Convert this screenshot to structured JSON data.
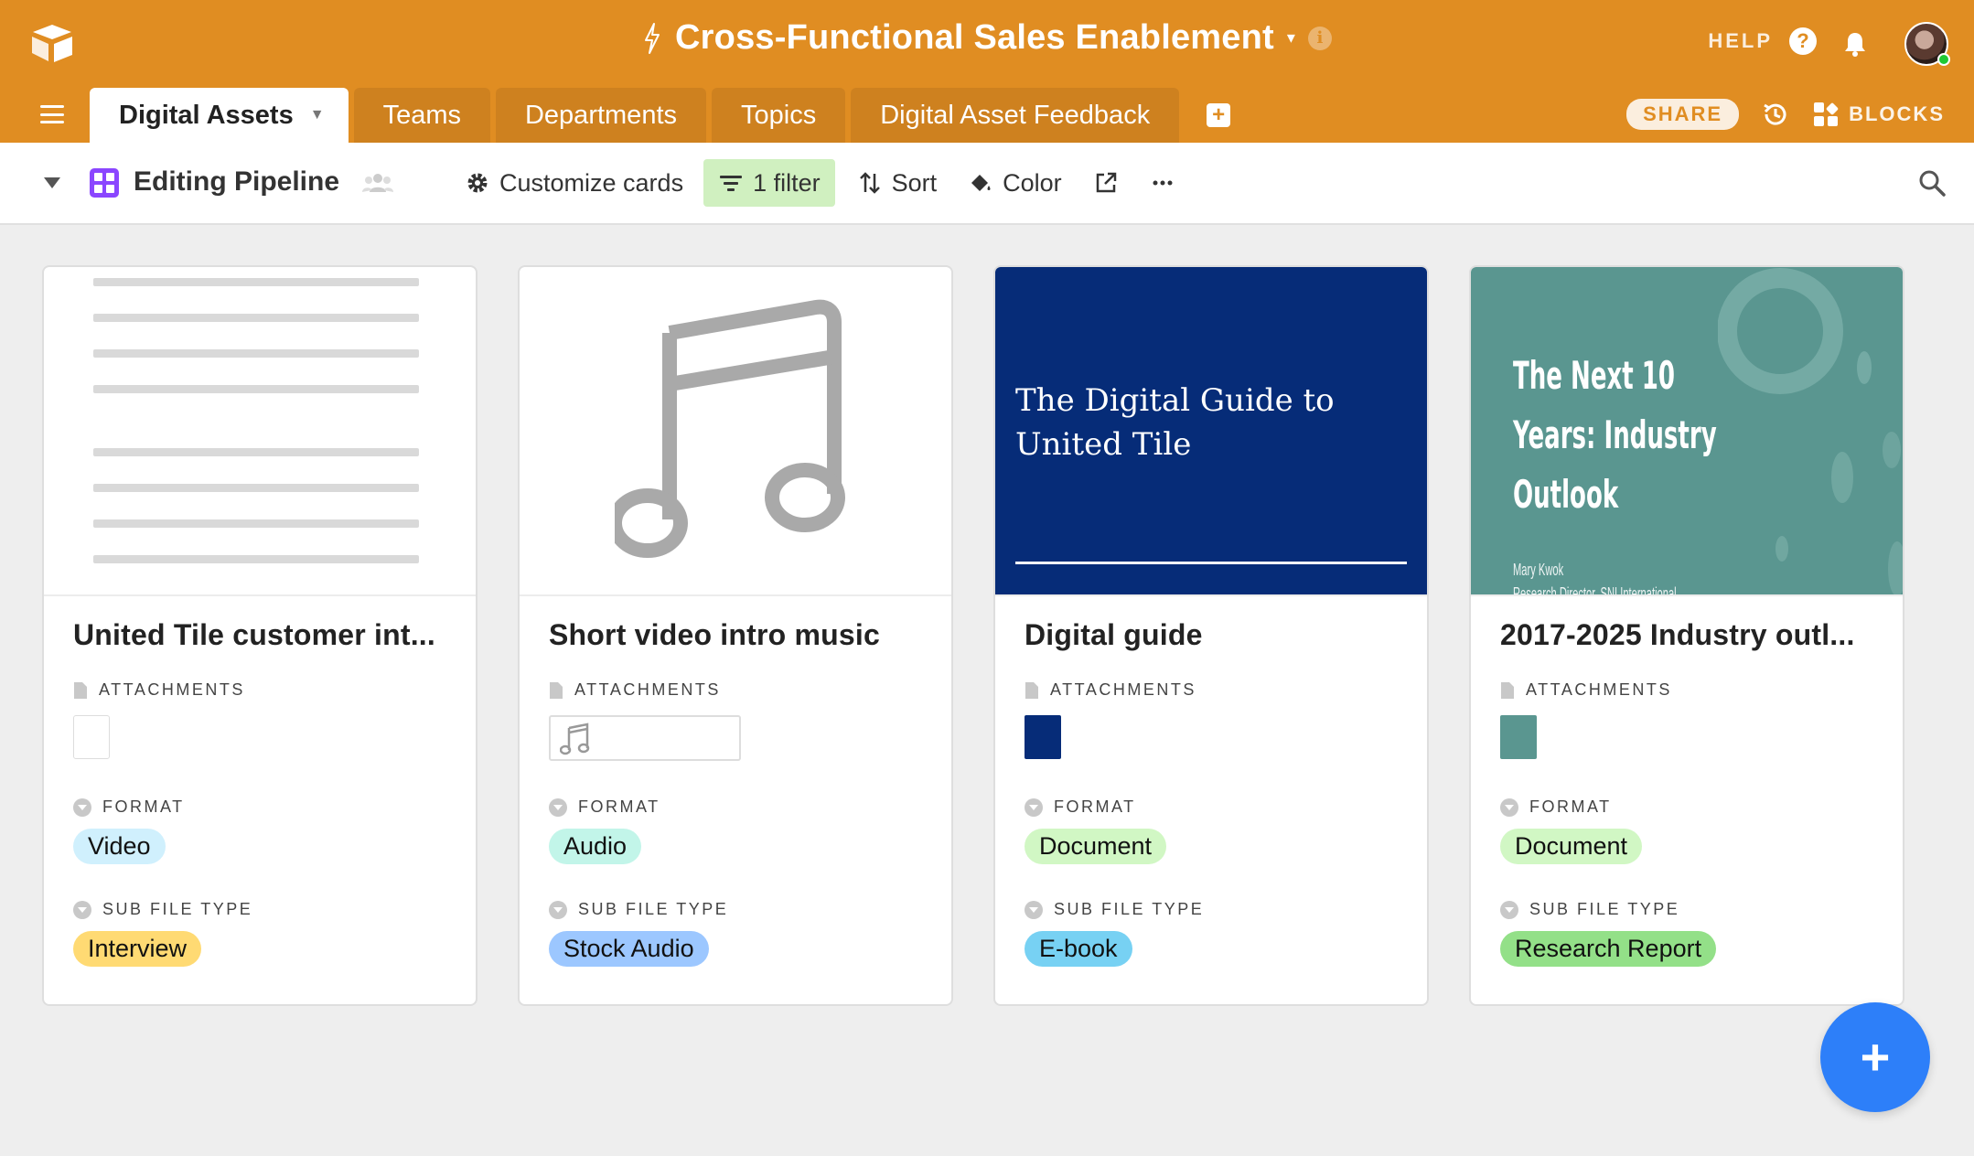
{
  "header": {
    "base_title": "Cross-Functional Sales Enablement",
    "help_label": "HELP",
    "help_glyph": "?",
    "info_glyph": "i",
    "share_label": "SHARE",
    "blocks_label": "BLOCKS",
    "add_tab_glyph": "+",
    "background_color": "#e08d22"
  },
  "tabs": [
    {
      "label": "Digital Assets",
      "active": true
    },
    {
      "label": "Teams"
    },
    {
      "label": "Departments"
    },
    {
      "label": "Topics"
    },
    {
      "label": "Digital Asset Feedback"
    }
  ],
  "viewbar": {
    "view_name": "Editing Pipeline",
    "customize_label": "Customize cards",
    "filter_label": "1 filter",
    "sort_label": "Sort",
    "color_label": "Color"
  },
  "field_labels": {
    "attachments": "ATTACHMENTS",
    "format": "FORMAT",
    "sub_file_type": "SUB FILE TYPE"
  },
  "cards": [
    {
      "title": "United Tile customer int...",
      "format": "Video",
      "format_color": "#d0f0fd",
      "sub_file_type": "Interview",
      "sub_color": "#ffda73",
      "cover": "document-lines"
    },
    {
      "title": "Short video intro music",
      "format": "Audio",
      "format_color": "#c2f5e9",
      "sub_file_type": "Stock Audio",
      "sub_color": "#9cc7ff",
      "cover": "music-note-icon"
    },
    {
      "title": "Digital guide",
      "format": "Document",
      "format_color": "#d1f7c4",
      "sub_file_type": "E-book",
      "sub_color": "#77d1f3",
      "cover": "blue-guide",
      "cover_text_line1": "The Digital Guide to",
      "cover_text_line2": "United Tile"
    },
    {
      "title": "2017-2025 Industry outl...",
      "format": "Document",
      "format_color": "#d1f7c4",
      "sub_file_type": "Research Report",
      "sub_color": "#93e088",
      "cover": "teal-report",
      "cover_title_line1": "The Next 10",
      "cover_title_line2": "Years: Industry",
      "cover_title_line3": "Outlook",
      "cover_author": "Mary Kwok",
      "cover_author_role": "Research Director, SNI International"
    }
  ],
  "fab_glyph": "+"
}
